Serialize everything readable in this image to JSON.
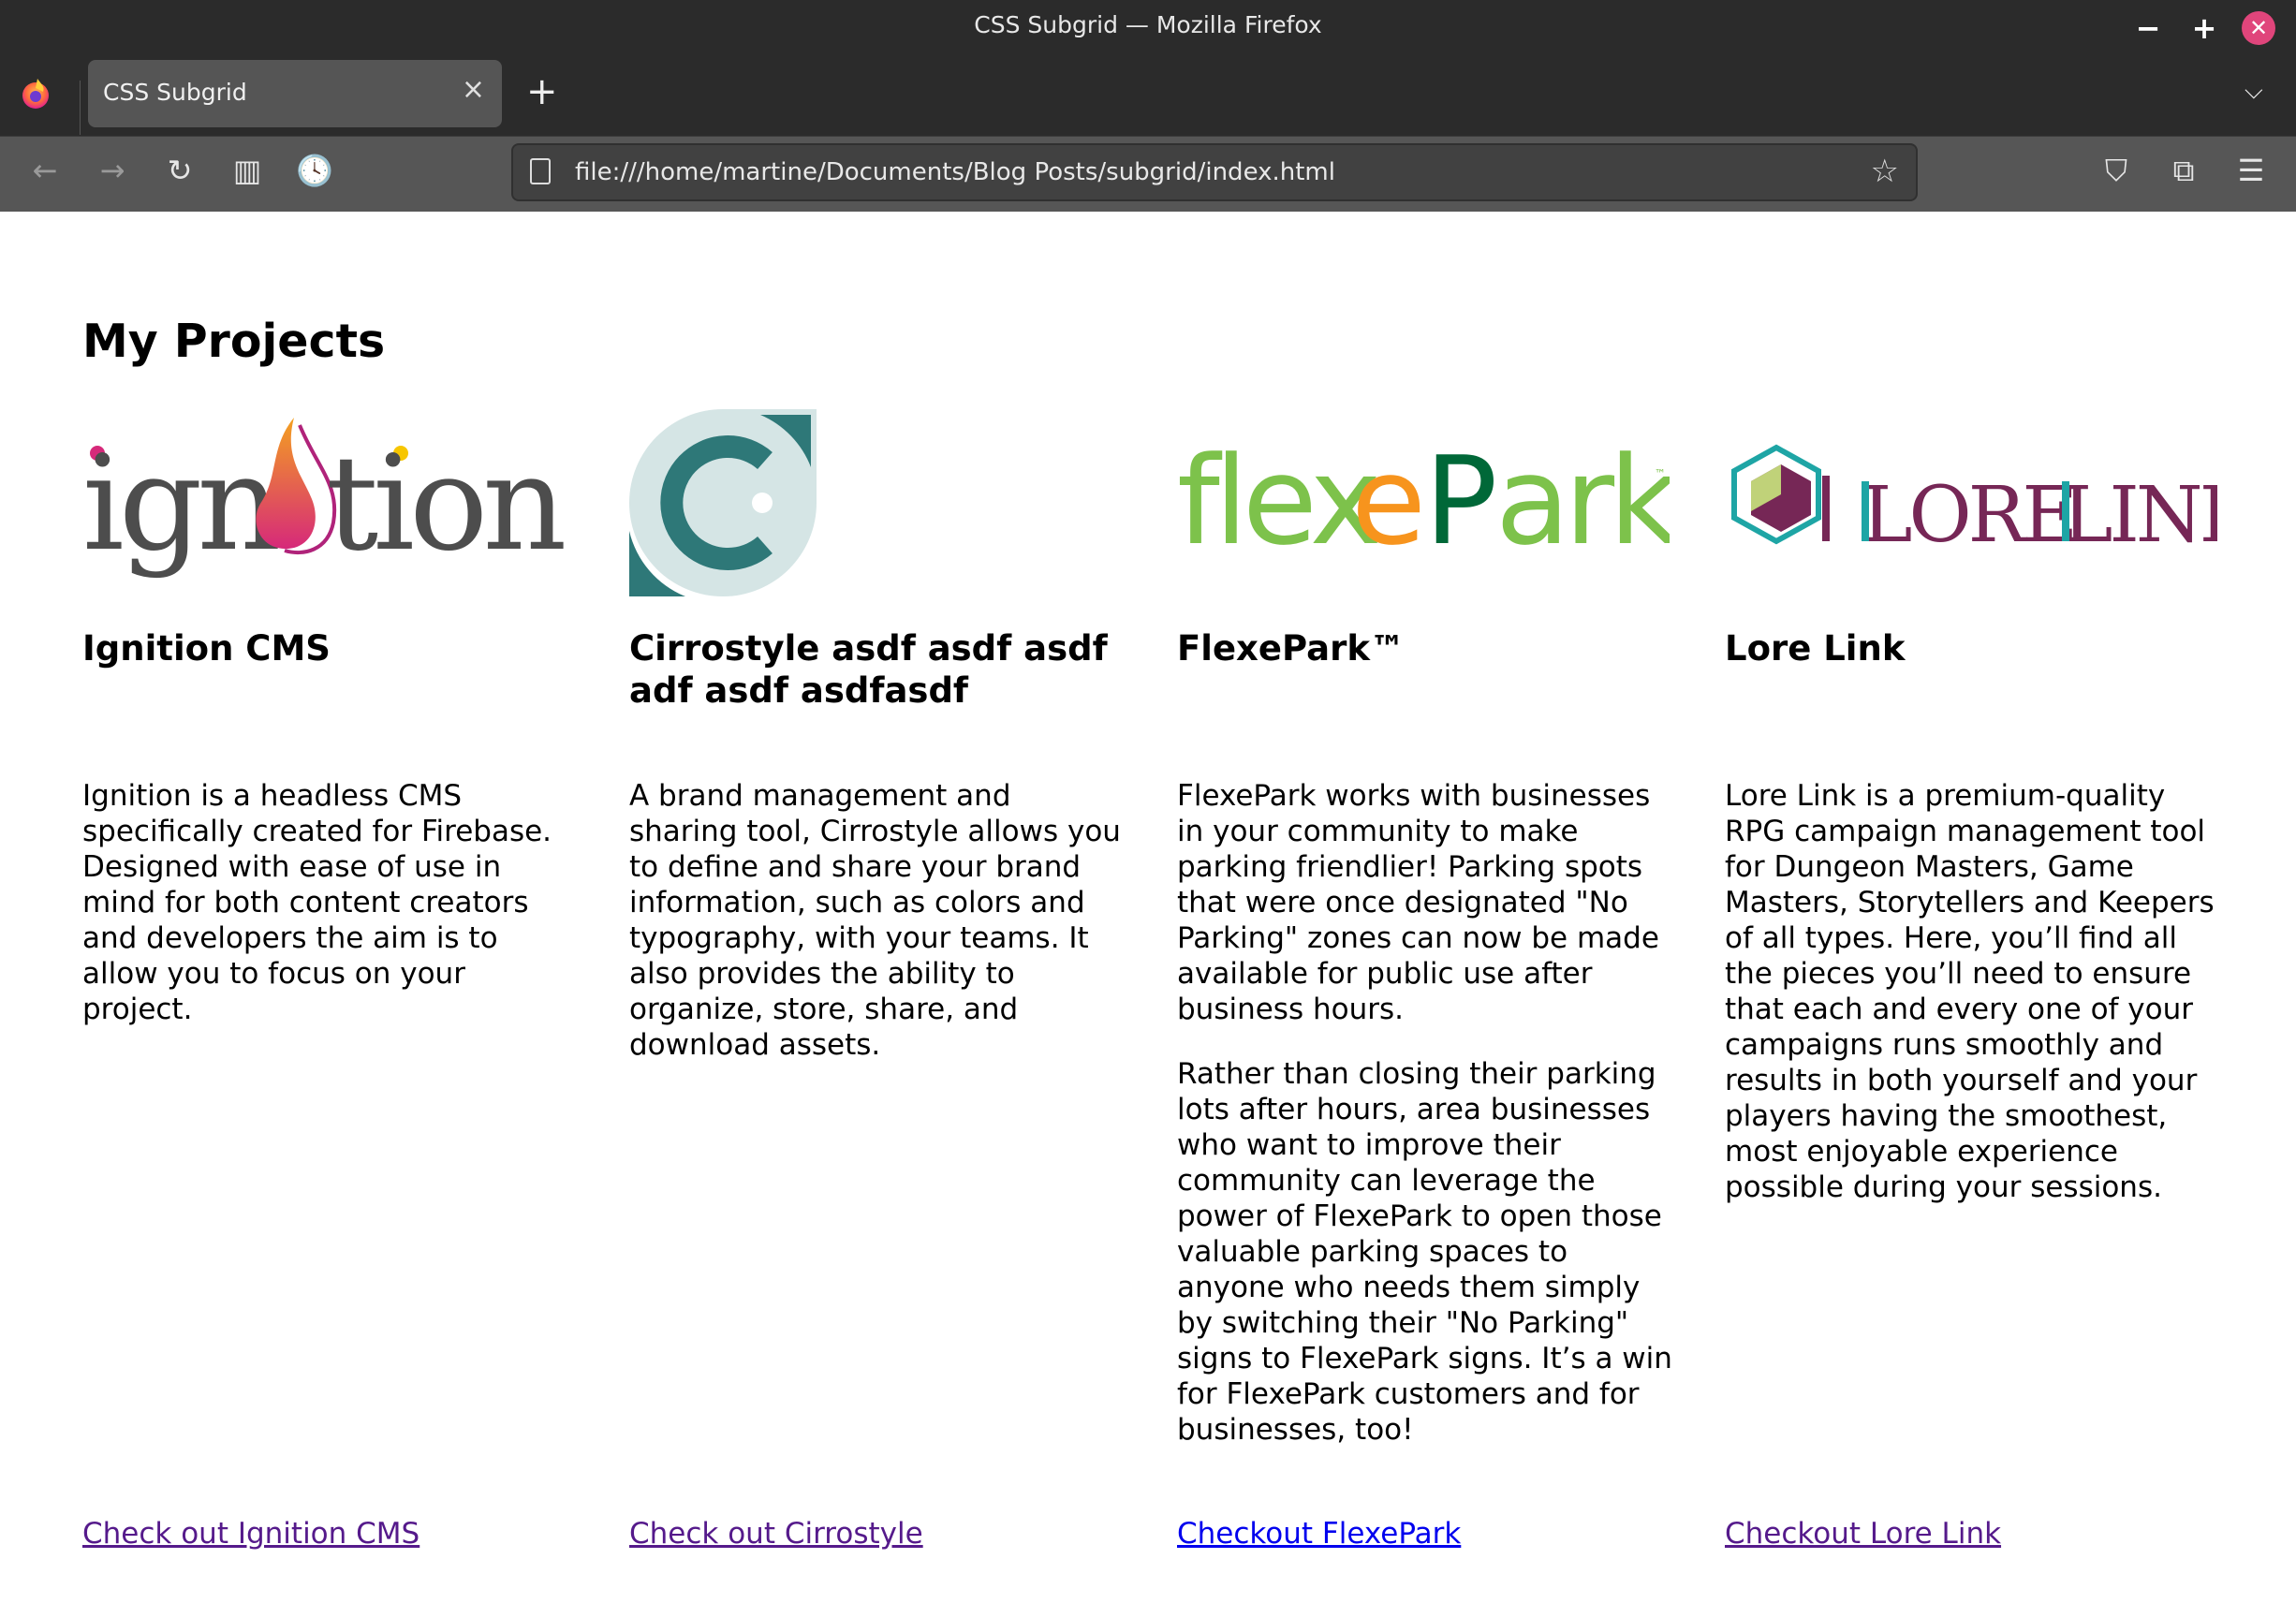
{
  "window": {
    "title": "CSS Subgrid — Mozilla Firefox",
    "controls": {
      "minimize": "−",
      "maximize": "+",
      "close": "✕"
    }
  },
  "tabs": [
    {
      "label": "CSS Subgrid",
      "active": true,
      "close_glyph": "×"
    }
  ],
  "tabbar": {
    "new_tab_glyph": "+",
    "list_all_tabs_glyph": "⌵"
  },
  "toolbar": {
    "back_glyph": "←",
    "forward_glyph": "→",
    "reload_glyph": "↻",
    "reader_glyph": "▥",
    "history_glyph": "🕓",
    "url": "file:///home/martine/Documents/Blog Posts/subgrid/index.html",
    "bookmark_glyph": "☆",
    "pocket_glyph": "⛉",
    "extensions_glyph": "⧉",
    "menu_glyph": "☰"
  },
  "page": {
    "heading": "My Projects",
    "projects": [
      {
        "name": "Ignition CMS",
        "logo": "ignition-logo",
        "logo_text": "ignition",
        "description": [
          "Ignition is a headless CMS specifically created for Firebase. Designed with ease of use in mind for both content creators and developers the aim is to allow you to focus on your project."
        ],
        "link_text": "Check out Ignition CMS",
        "link_visited": true
      },
      {
        "name": "Cirrostyle asdf asdf asdf adf asdf asdfasdf",
        "logo": "cirrostyle-logo",
        "logo_text": "C",
        "description": [
          "A brand management and sharing tool, Cirrostyle allows you to define and share your brand information, such as colors and typography, with your teams. It also provides the ability to organize, store, share, and download assets."
        ],
        "link_text": "Check out Cirrostyle",
        "link_visited": true
      },
      {
        "name": "FlexePark™",
        "logo": "flexepark-logo",
        "logo_text": {
          "part1": "flex",
          "part2": "e",
          "part3": "Park",
          "tm": "™"
        },
        "description": [
          "FlexePark works with businesses in your community to make parking friendlier! Parking spots that were once designated \"No Parking\" zones can now be made available for public use after business hours.",
          "Rather than closing their parking lots after hours, area businesses who want to improve their community can leverage the power of FlexePark to open those valuable parking spaces to anyone who needs them simply by switching their \"No Parking\" signs to FlexePark signs. It’s a win for FlexePark customers and for businesses, too!"
        ],
        "link_text": "Checkout FlexePark",
        "link_visited": false
      },
      {
        "name": "Lore Link",
        "logo": "lorelink-logo",
        "logo_text": {
          "word1": "LORE",
          "word2": "LINK"
        },
        "description": [
          "Lore Link is a premium-quality RPG campaign management tool for Dungeon Masters, Game Masters, Storytellers and Keepers of all types. Here, you’ll find all the pieces you’ll need to ensure that each and every one of your campaigns runs smoothly and results in both yourself and your players having the smoothest, most enjoyable experience possible during your sessions."
        ],
        "link_text": "Checkout Lore Link",
        "link_visited": true
      }
    ]
  },
  "colors": {
    "link_visited": "#551a8b",
    "link_unvisited": "#0000ee",
    "ignition_gray": "#4d4d4d",
    "ignition_flame_pink": "#d6297a",
    "ignition_flame_orange": "#f4a020",
    "cirrostyle_teal": "#2e7878",
    "cirrostyle_light": "#d5e5e5",
    "flexepark_light_green": "#7dc24b",
    "flexepark_orange": "#f7941d",
    "flexepark_dark_green": "#006838",
    "lorelink_purple": "#762756",
    "lorelink_teal": "#1ea5a5",
    "lorelink_lime": "#c0d279",
    "close_button": "#e0457b"
  }
}
